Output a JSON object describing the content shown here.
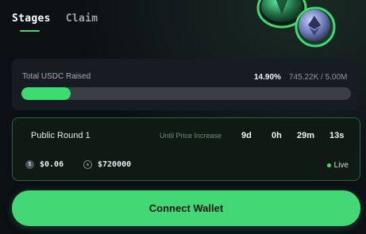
{
  "tabs": [
    {
      "label": "Stages",
      "active": true
    },
    {
      "label": "Claim",
      "active": false
    }
  ],
  "raised": {
    "label": "Total USDC Raised",
    "percent": "14.90%",
    "amount": "745.22K / 5.00M",
    "progress_fraction": 0.149
  },
  "round": {
    "name": "Public Round 1",
    "until_label": "Until Price Increase",
    "countdown": {
      "days": "9d",
      "hours": "0h",
      "minutes": "29m",
      "seconds": "13s"
    },
    "price": "$0.06",
    "target": "$720000",
    "status": "Live"
  },
  "connect_label": "Connect Wallet",
  "colors": {
    "accent": "#3ddc73",
    "background": "#0c0f14"
  },
  "icons": {
    "price": "dollar-icon",
    "target": "target-icon",
    "status": "live-dot-icon"
  }
}
